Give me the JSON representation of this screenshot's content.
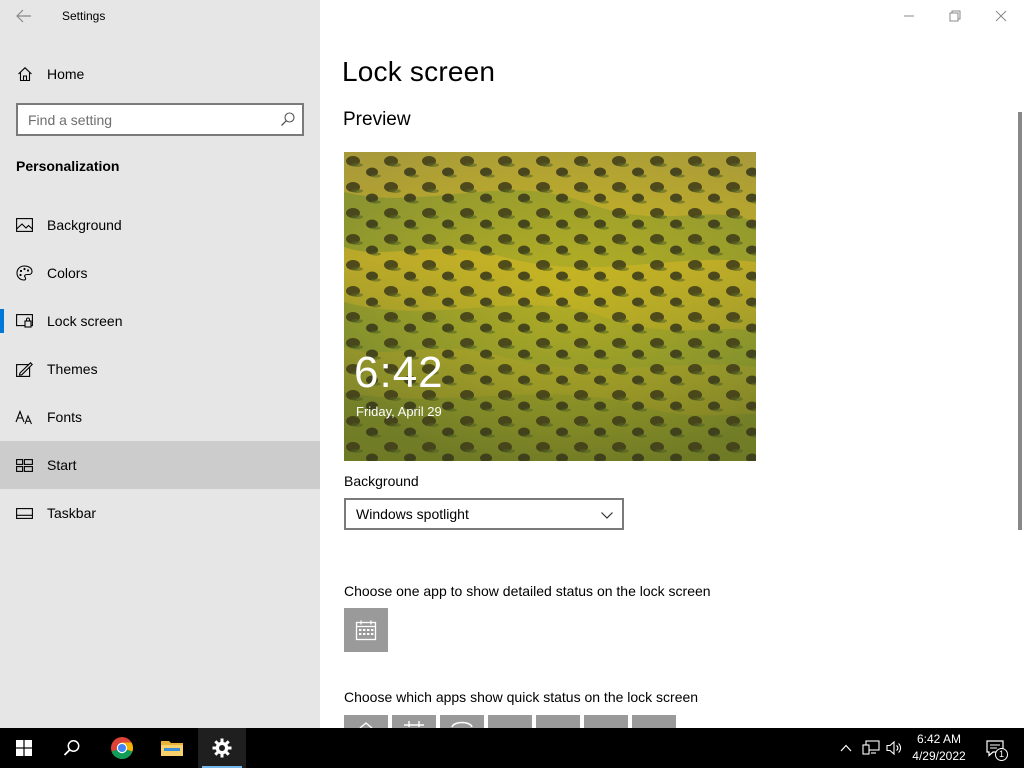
{
  "window": {
    "app_title": "Settings",
    "controls": [
      "minimize",
      "maximize",
      "close"
    ]
  },
  "sidebar": {
    "home_label": "Home",
    "search_placeholder": "Find a setting",
    "section_title": "Personalization",
    "items": [
      {
        "label": "Background",
        "icon": "picture-icon"
      },
      {
        "label": "Colors",
        "icon": "palette-icon"
      },
      {
        "label": "Lock screen",
        "icon": "lock-screen-icon",
        "selected": true
      },
      {
        "label": "Themes",
        "icon": "themes-icon"
      },
      {
        "label": "Fonts",
        "icon": "fonts-icon"
      },
      {
        "label": "Start",
        "icon": "start-icon",
        "hovered": true
      },
      {
        "label": "Taskbar",
        "icon": "taskbar-icon"
      }
    ]
  },
  "main": {
    "page_title": "Lock screen",
    "preview_heading": "Preview",
    "preview_time": "6:42",
    "preview_date": "Friday, April 29",
    "background_label": "Background",
    "background_value": "Windows spotlight",
    "detailed_status_label": "Choose one app to show detailed status on the lock screen",
    "detailed_status_app": "calendar-icon",
    "quick_status_label": "Choose which apps show quick status on the lock screen",
    "quick_status_apps": [
      "mail-icon",
      "calendar-icon",
      "chat-icon",
      "add-icon",
      "add-icon",
      "add-icon",
      "add-icon"
    ]
  },
  "taskbar": {
    "apps": [
      "windows-start-icon",
      "search-icon",
      "chrome-icon",
      "file-explorer-icon",
      "settings-gear-icon"
    ],
    "active_app": "settings-gear-icon",
    "tray": [
      "chevron-up-icon",
      "network-icon",
      "volume-icon"
    ],
    "clock_time": "6:42 AM",
    "clock_date": "4/29/2022",
    "notification_count": "1"
  },
  "colors": {
    "sidebar_bg": "#e6e6e6",
    "accent": "#0078d7",
    "taskbar_bg": "#000000",
    "tile_bg": "#9a9a9a"
  }
}
